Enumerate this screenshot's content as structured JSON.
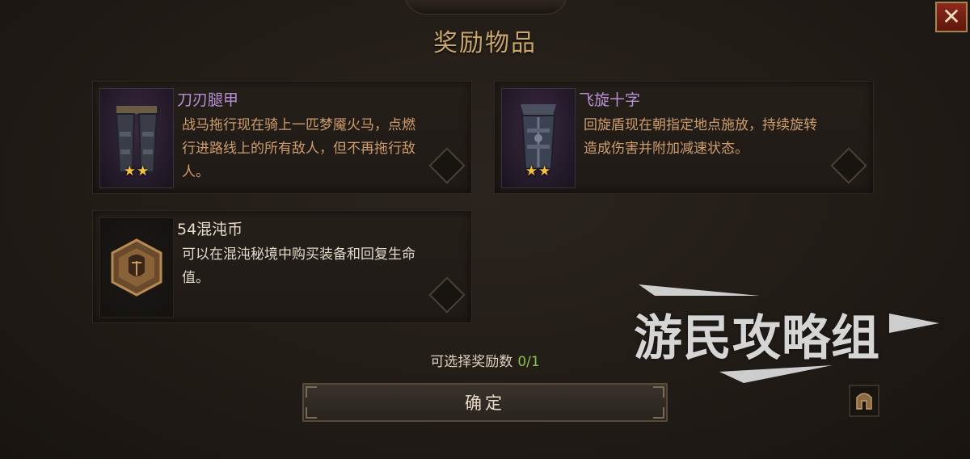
{
  "title": "奖励物品",
  "close_label": "✕",
  "rewards": [
    {
      "name": "刀刃腿甲",
      "description": "战马拖行现在骑上一匹梦魇火马，点燃行进路线上的所有敌人，但不再拖行敌人。",
      "stars": "★★",
      "icon": "leg-armor-icon"
    },
    {
      "name": "飞旋十字",
      "description": "回旋盾现在朝指定地点施放，持续旋转造成伤害并附加减速状态。",
      "stars": "★★",
      "icon": "chest-armor-icon"
    },
    {
      "name": "54混沌币",
      "description": "可以在混沌秘境中购买装备和回复生命值。",
      "stars": "",
      "icon": "chaos-coin-icon"
    }
  ],
  "selection": {
    "label": "可选择奖励数",
    "value": "0/1"
  },
  "confirm_label": "确定",
  "watermark": "游民攻略组",
  "colors": {
    "item_name_epic": "#b98fd6",
    "item_desc": "#cf9d6c",
    "count_value": "#8bc34a",
    "close_button": "#8c2a1c"
  }
}
